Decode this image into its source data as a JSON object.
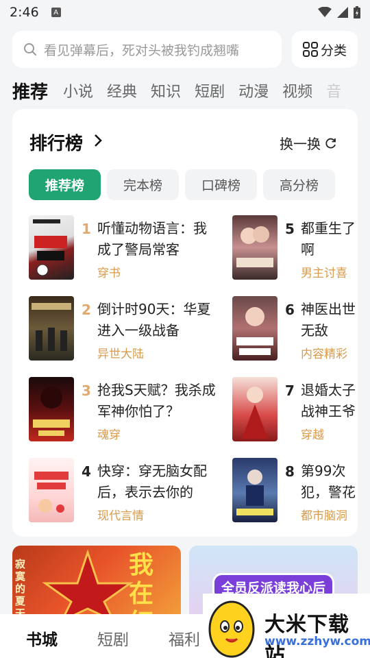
{
  "status_bar": {
    "time": "2:46",
    "badge": "A"
  },
  "search": {
    "placeholder": "看见弹幕后，死对头被我钓成翘嘴"
  },
  "category_button": {
    "label": "分类"
  },
  "top_tabs": [
    "推荐",
    "小说",
    "经典",
    "知识",
    "短剧",
    "动漫",
    "视频",
    "音"
  ],
  "ranking": {
    "title": "排行榜",
    "refresh_label": "换一换",
    "pills": [
      "推荐榜",
      "完本榜",
      "口碑榜",
      "高分榜"
    ],
    "books": [
      {
        "rank": "1",
        "title": "听懂动物语言：我成了警局常客",
        "tag": "穿书"
      },
      {
        "rank": "2",
        "title": "倒计时90天：华夏进入一级战备",
        "tag": "异世大陆"
      },
      {
        "rank": "3",
        "title": "抢我S天赋？我杀成军神你怕了？",
        "tag": "魂穿"
      },
      {
        "rank": "4",
        "title": "快穿：穿无脑女配后，表示去你的",
        "tag": "现代言情"
      },
      {
        "rank": "5",
        "title": "都重生了啊",
        "tag": "男主讨喜"
      },
      {
        "rank": "6",
        "title": "神医出世无敌",
        "tag": "内容精彩"
      },
      {
        "rank": "7",
        "title": "退婚太子战神王爷",
        "tag": "穿越"
      },
      {
        "rank": "8",
        "title": "第99次犯，警花",
        "tag": "都市脑洞"
      }
    ]
  },
  "banners": [
    {
      "text": "我在红",
      "side_text": "寂寞的夏天"
    },
    {
      "text": "全员反派读我心后"
    }
  ],
  "bottom_nav": [
    "书城",
    "短剧",
    "福利"
  ],
  "watermark": {
    "title": "大米下载站",
    "url": "www.zzhyw.com"
  },
  "colors": {
    "accent": "#1fa472",
    "tag": "#d99a4a",
    "rank_top3": "#e0a96d",
    "rank_rest": "#222222"
  }
}
